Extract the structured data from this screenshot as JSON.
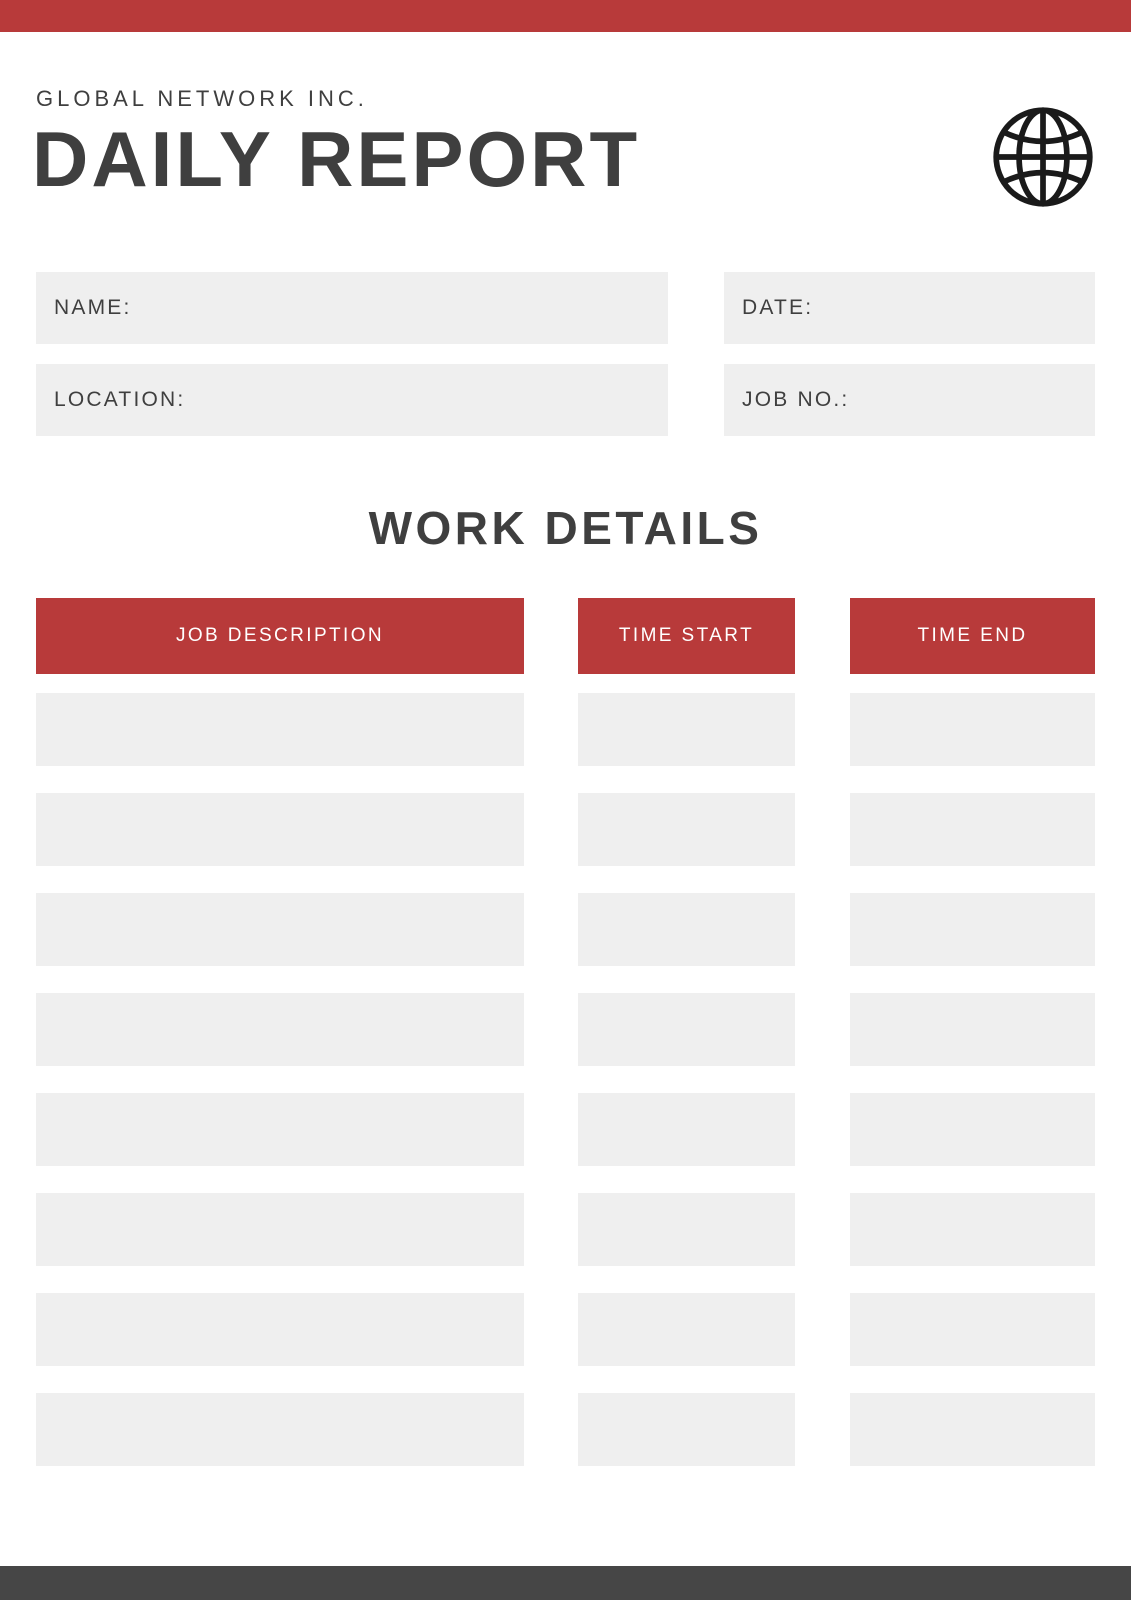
{
  "theme": {
    "accent_red": "#b83a3a",
    "dark_gray": "#464646",
    "text_gray": "#3f3f3f",
    "field_gray": "#efefef"
  },
  "header": {
    "company": "GLOBAL NETWORK INC.",
    "title": "DAILY REPORT",
    "logo_icon": "globe-icon"
  },
  "meta": {
    "fields": [
      {
        "label": "NAME:",
        "value": ""
      },
      {
        "label": "DATE:",
        "value": ""
      },
      {
        "label": "LOCATION:",
        "value": ""
      },
      {
        "label": "JOB NO.:",
        "value": ""
      }
    ]
  },
  "work_details": {
    "section_title": "WORK DETAILS",
    "columns": [
      {
        "label": "JOB DESCRIPTION"
      },
      {
        "label": "TIME START"
      },
      {
        "label": "TIME END"
      }
    ],
    "rows": [
      {
        "job_description": "",
        "time_start": "",
        "time_end": ""
      },
      {
        "job_description": "",
        "time_start": "",
        "time_end": ""
      },
      {
        "job_description": "",
        "time_start": "",
        "time_end": ""
      },
      {
        "job_description": "",
        "time_start": "",
        "time_end": ""
      },
      {
        "job_description": "",
        "time_start": "",
        "time_end": ""
      },
      {
        "job_description": "",
        "time_start": "",
        "time_end": ""
      },
      {
        "job_description": "",
        "time_start": "",
        "time_end": ""
      },
      {
        "job_description": "",
        "time_start": "",
        "time_end": ""
      }
    ]
  }
}
